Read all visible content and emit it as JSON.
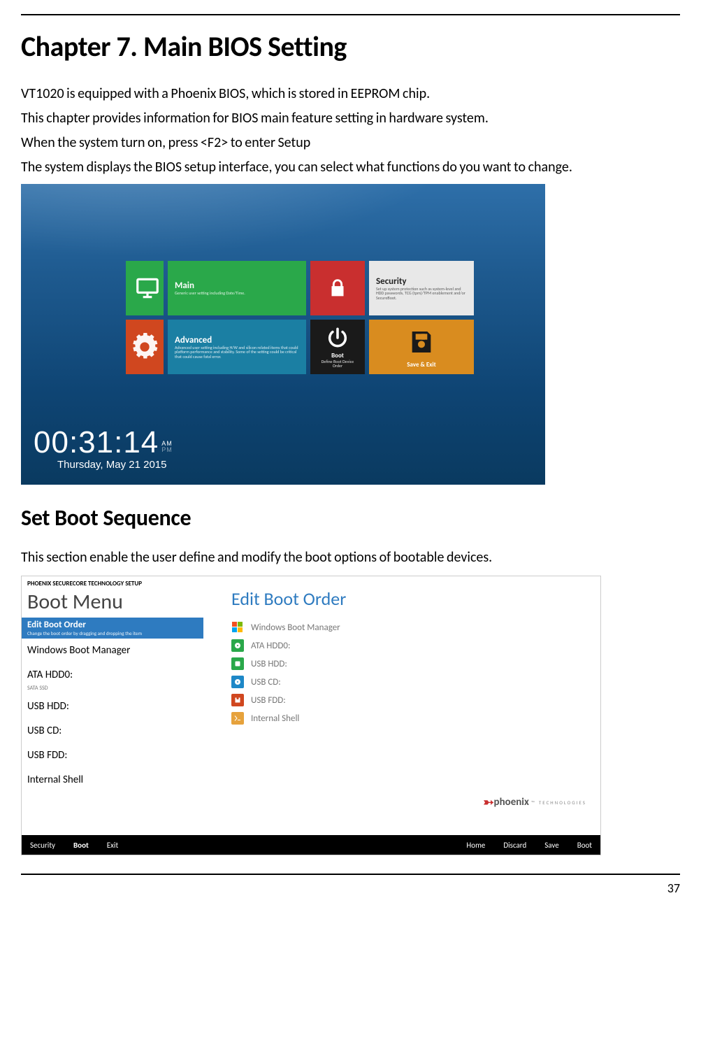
{
  "page": {
    "title": "Chapter 7. Main BIOS Setting",
    "intro_lines": [
      "VT1020 is equipped with a Phoenix BIOS, which is stored in EEPROM chip.",
      "This chapter provides information for BIOS main feature setting in hardware system.",
      "When the system turn on, press <F2> to enter Setup",
      "The system displays the BIOS setup interface, you can select what functions do you want to change."
    ],
    "subheading": "Set Boot Sequence",
    "subtext": "This section enable the user define and modify the boot options of bootable devices.",
    "page_number": "37"
  },
  "bios_home": {
    "tiles": {
      "main": {
        "label": "Main",
        "desc": "Generic user setting including Date/Time."
      },
      "security": {
        "label": "Security",
        "desc": "Set up system protection such as system-level and HDD passwords, TCG (tpm)/TPM enablement and/or SecureBoot."
      },
      "advanced": {
        "label": "Advanced",
        "desc": "Advanced user setting including H/W and silicon related items that could platform performance and stability. Some of the setting could be critical that could cause fatal error."
      },
      "boot": {
        "label": "Boot",
        "desc": "Define Boot Device Order"
      },
      "save": {
        "label": "Save & Exit"
      }
    },
    "clock": {
      "time": "00:31:14",
      "am": "AM",
      "pm": "PM",
      "date": "Thursday, May 21 2015"
    }
  },
  "boot_menu": {
    "brand_header": "PHOENIX SECURECORE TECHNOLOGY SETUP",
    "left_title": "Boot Menu",
    "edit_bar": {
      "title": "Edit Boot Order",
      "hint": "Change the boot order by dragging and dropping the item"
    },
    "left_items": [
      "Windows Boot Manager",
      "ATA HDD0:",
      "USB HDD:",
      "USB CD:",
      "USB FDD:",
      "Internal Shell"
    ],
    "left_sub_after_ata": "SATA SSD",
    "right_title": "Edit Boot Order",
    "right_items": [
      "Windows Boot Manager",
      "ATA HDD0:",
      "USB HDD:",
      "USB CD:",
      "USB FDD:",
      "Internal Shell"
    ],
    "brand": {
      "name": "phoenix",
      "sub": "TECHNOLOGIES"
    },
    "footer_left": [
      "Security",
      "Boot",
      "Exit"
    ],
    "footer_right": [
      "Home",
      "Discard",
      "Save",
      "Boot"
    ]
  }
}
